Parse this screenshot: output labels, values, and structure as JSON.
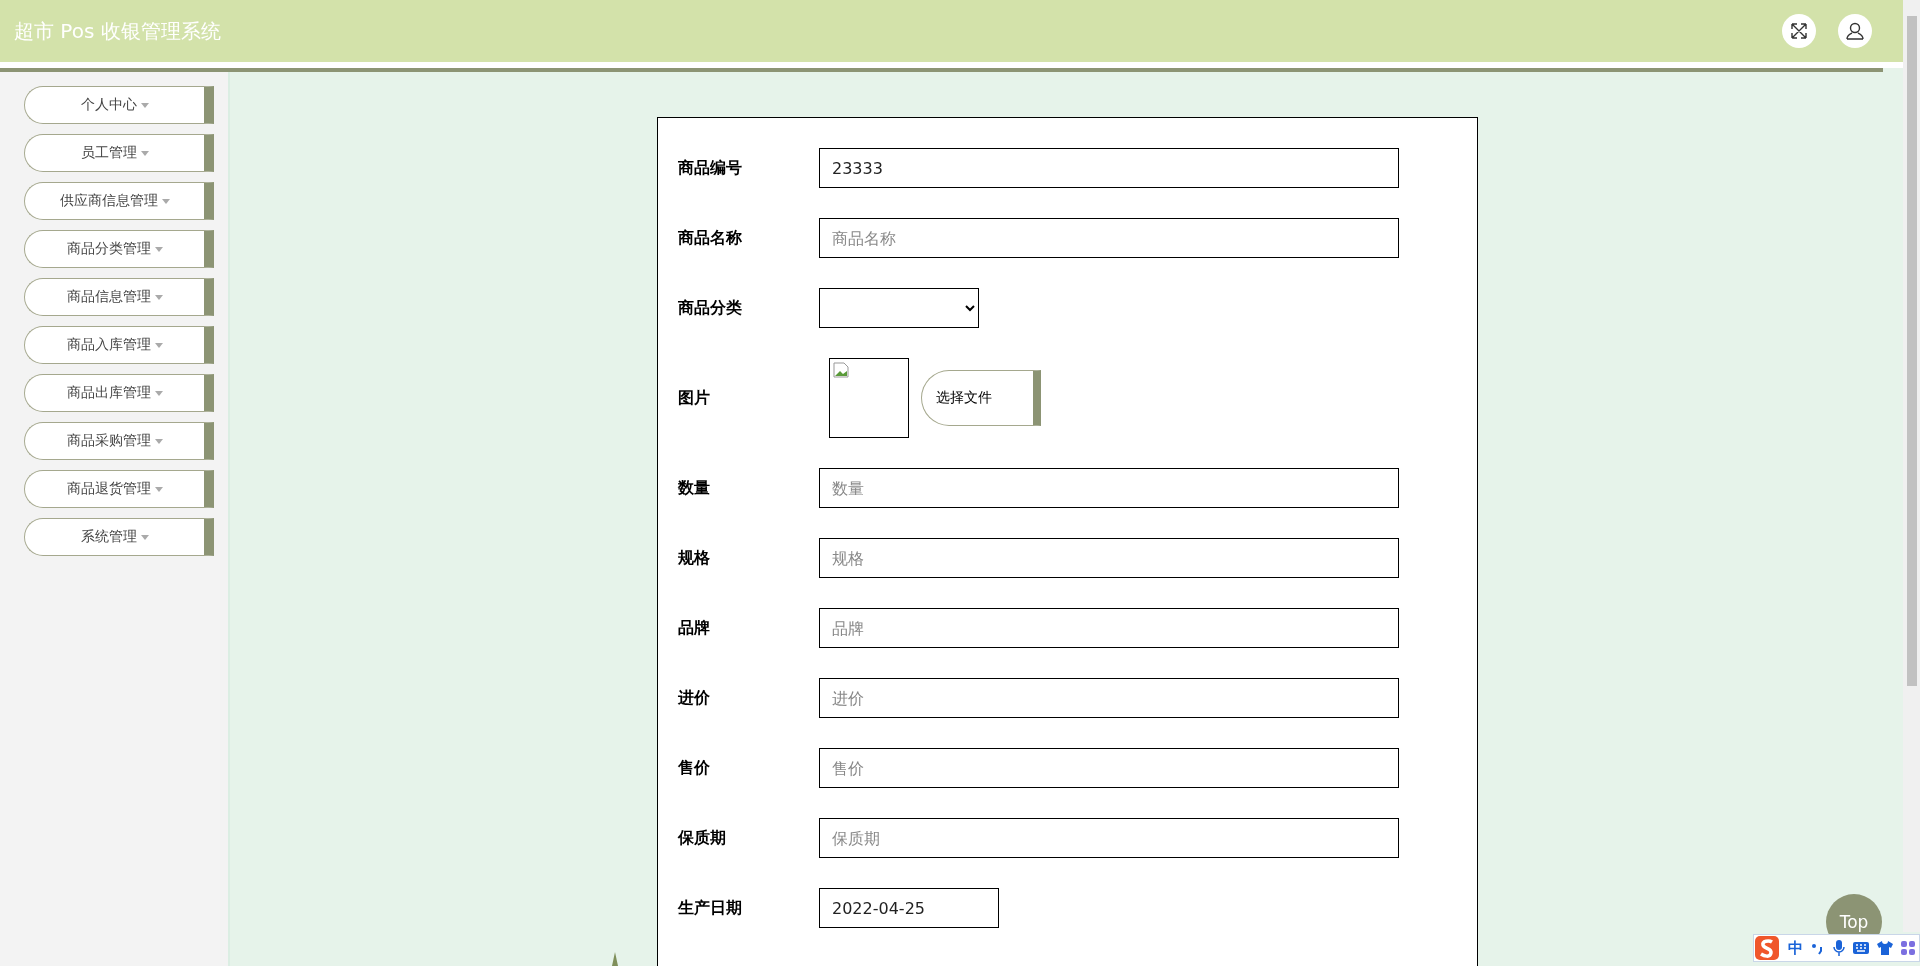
{
  "header": {
    "title": "超市 Pos 收银管理系统"
  },
  "sidebar": {
    "items": [
      {
        "label": "个人中心"
      },
      {
        "label": "员工管理"
      },
      {
        "label": "供应商信息管理"
      },
      {
        "label": "商品分类管理"
      },
      {
        "label": "商品信息管理"
      },
      {
        "label": "商品入库管理"
      },
      {
        "label": "商品出库管理"
      },
      {
        "label": "商品采购管理"
      },
      {
        "label": "商品退货管理"
      },
      {
        "label": "系统管理"
      }
    ]
  },
  "form": {
    "fields": [
      {
        "kind": "text",
        "label": "商品编号",
        "value": "23333"
      },
      {
        "kind": "text",
        "label": "商品名称",
        "placeholder": "商品名称"
      },
      {
        "kind": "select",
        "label": "商品分类"
      },
      {
        "kind": "image",
        "label": "图片",
        "button": "选择文件"
      },
      {
        "kind": "text",
        "label": "数量",
        "placeholder": "数量"
      },
      {
        "kind": "text",
        "label": "规格",
        "placeholder": "规格"
      },
      {
        "kind": "text",
        "label": "品牌",
        "placeholder": "品牌"
      },
      {
        "kind": "text",
        "label": "进价",
        "placeholder": "进价"
      },
      {
        "kind": "text",
        "label": "售价",
        "placeholder": "售价"
      },
      {
        "kind": "text",
        "label": "保质期",
        "placeholder": "保质期"
      },
      {
        "kind": "date",
        "label": "生产日期",
        "value": "2022-04-25"
      }
    ]
  },
  "top_button": {
    "label": "Top"
  },
  "ime_toolbar": {
    "mode": "中"
  }
}
